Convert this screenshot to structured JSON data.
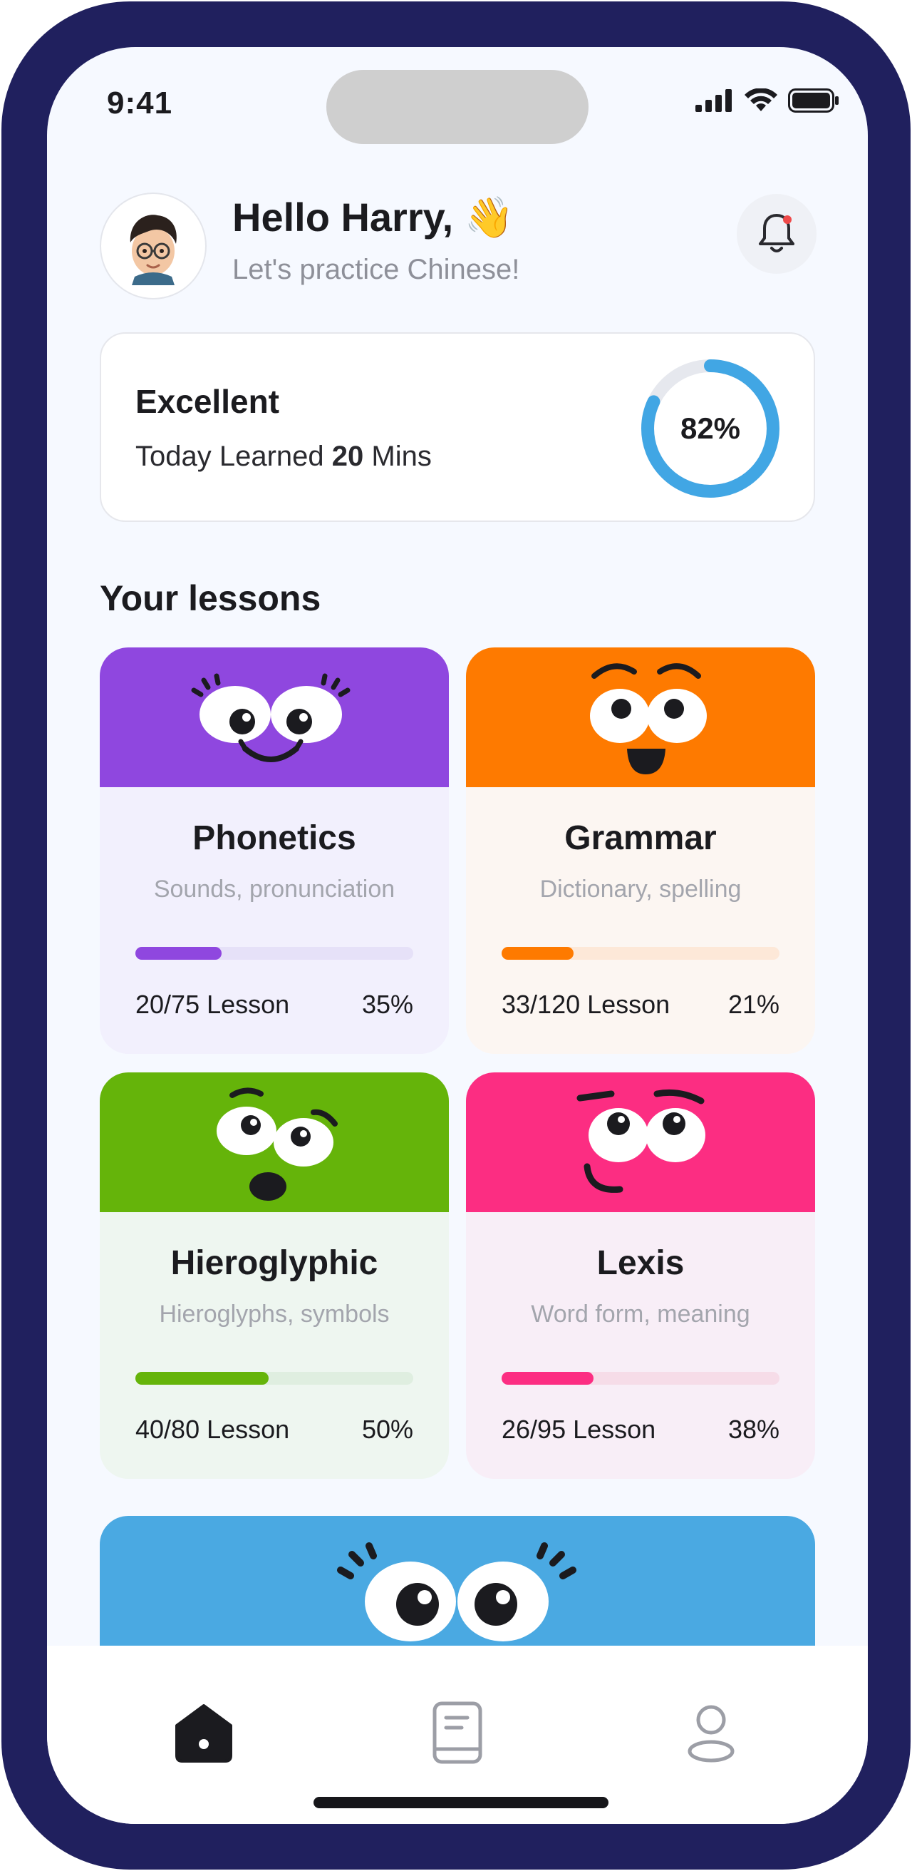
{
  "status_bar": {
    "time": "9:41"
  },
  "header": {
    "greeting": "Hello Harry,",
    "greeting_emoji": "👋",
    "subtitle": "Let's practice Chinese!",
    "avatar_icon": "avatar-memoji",
    "notification_icon": "bell-icon"
  },
  "summary": {
    "title": "Excellent",
    "line_prefix": "Today Learned",
    "minutes": "20",
    "line_suffix": "Mins",
    "progress_label": "82%",
    "progress_value": 0.82,
    "ring_color": "#41a6e4"
  },
  "lessons_title": "Your lessons",
  "lessons": [
    {
      "name": "Phonetics",
      "desc": "Sounds, pronunciation",
      "count": "20/75 Lesson",
      "percent": "35%",
      "progress": 0.31,
      "color": "#8f47df",
      "bg": "#f2f0fd",
      "track": "#e6e1f8"
    },
    {
      "name": "Grammar",
      "desc": "Dictionary, spelling",
      "count": "33/120 Lesson",
      "percent": "21%",
      "progress": 0.26,
      "color": "#fe7a00",
      "bg": "#fcf6f2",
      "track": "#fde8d8"
    },
    {
      "name": "Hieroglyphic",
      "desc": "Hieroglyphs, symbols",
      "count": "40/80 Lesson",
      "percent": "50%",
      "progress": 0.48,
      "color": "#65b40a",
      "bg": "#eef6f0",
      "track": "#dfeee0"
    },
    {
      "name": "Lexis",
      "desc": "Word form, meaning",
      "count": "26/95 Lesson",
      "percent": "38%",
      "progress": 0.33,
      "color": "#fc2d82",
      "bg": "#f8eef7",
      "track": "#f6dce8"
    }
  ],
  "tabbar": {
    "home_icon": "home-icon",
    "lessons_icon": "book-icon",
    "profile_icon": "user-icon"
  }
}
